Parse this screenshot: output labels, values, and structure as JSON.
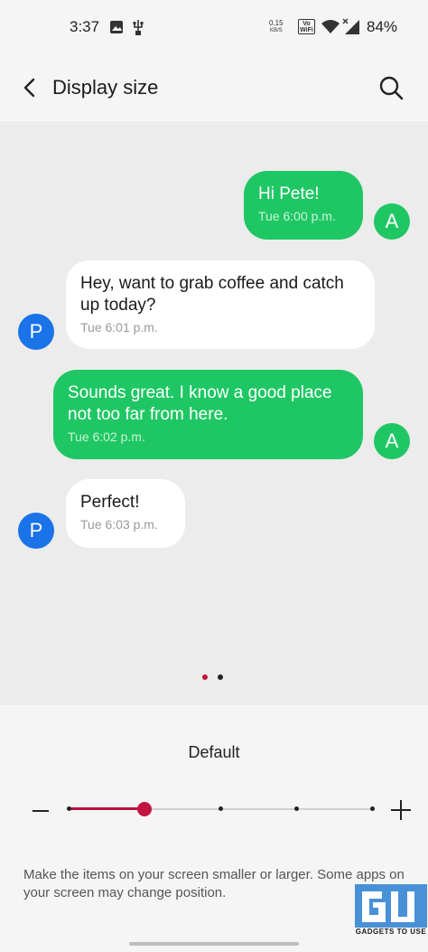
{
  "status_bar": {
    "time": "3:37",
    "net_speed_value": "0.15",
    "net_speed_unit": "KB/S",
    "volte": "Vo WiFi",
    "battery": "84%",
    "icons": [
      "image-icon",
      "usb-icon",
      "wifi-icon",
      "signal-icon"
    ]
  },
  "app_bar": {
    "title": "Display size",
    "back_icon": "back-arrow-icon",
    "search_icon": "search-icon"
  },
  "conversation": {
    "messages": [
      {
        "sender": "A",
        "direction": "out",
        "text": "Hi Pete!",
        "time": "Tue 6:00 p.m."
      },
      {
        "sender": "P",
        "direction": "in",
        "text": "Hey, want to grab coffee and catch up today?",
        "time": "Tue 6:01 p.m."
      },
      {
        "sender": "A",
        "direction": "out",
        "text": "Sounds great. I know a good place not too far from here.",
        "time": "Tue 6:02 p.m."
      },
      {
        "sender": "P",
        "direction": "in",
        "text": "Perfect!",
        "time": "Tue 6:03 p.m."
      }
    ],
    "page_indicator": {
      "count": 2,
      "active": 0
    }
  },
  "size_control": {
    "current_label": "Default",
    "steps": 5,
    "selected_step": 1,
    "decrease_icon": "minus-icon",
    "increase_icon": "plus-icon",
    "description": "Make the items on your screen smaller or larger. Some apps on your screen may change position."
  },
  "watermark": {
    "text": "GADGETS TO USE"
  },
  "colors": {
    "outgoing_bubble": "#1fc764",
    "incoming_bubble": "#ffffff",
    "avatar_a": "#1fc764",
    "avatar_p": "#1a73e8",
    "slider_accent": "#c2143e"
  }
}
